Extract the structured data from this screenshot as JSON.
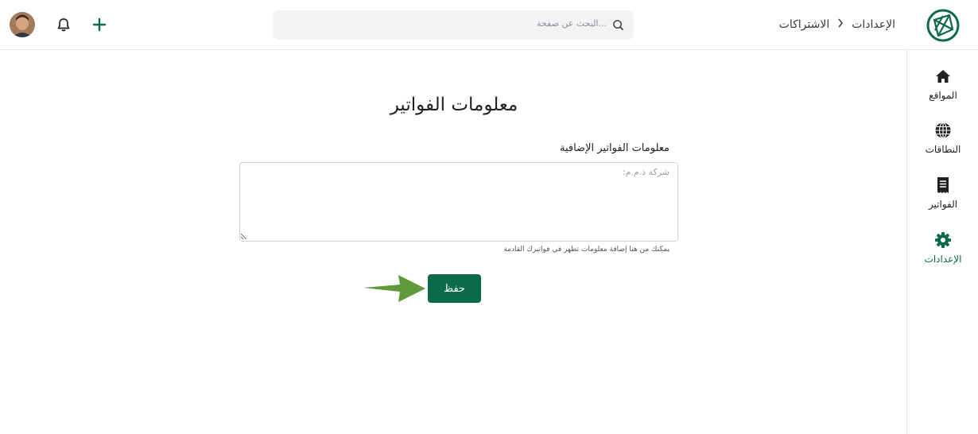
{
  "header": {
    "breadcrumb": [
      {
        "label": "الإعدادات"
      },
      {
        "label": "الاشتراكات"
      }
    ],
    "search": {
      "placeholder": "البحث عن صفحة..."
    },
    "icons": [
      "logo-icon",
      "search-icon",
      "bell-icon",
      "plus-icon",
      "avatar"
    ]
  },
  "sidebar": {
    "items": [
      {
        "label": "المواقع",
        "icon": "home-icon",
        "active": false
      },
      {
        "label": "النطاقات",
        "icon": "globe-icon",
        "active": false
      },
      {
        "label": "الفواتير",
        "icon": "receipt-icon",
        "active": false
      },
      {
        "label": "الإعدادات",
        "icon": "gear-icon",
        "active": true
      }
    ]
  },
  "main": {
    "title": "معلومات الفواتير",
    "field_label": "معلومات الفواتير الإضافية",
    "textarea_placeholder": "شركة ذ.م.م:",
    "hint": "يمكنك من هنا إضافة معلومات تظهر في فواتيرك القادمة",
    "save_label": "حفظ"
  },
  "colors": {
    "accent": "#0b6b48",
    "arrow": "#5e9a3a",
    "search_bg": "#f2f3f5"
  }
}
